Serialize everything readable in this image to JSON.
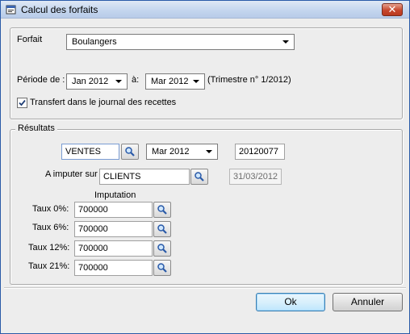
{
  "window": {
    "title": "Calcul des forfaits",
    "close_label": "✕"
  },
  "forfait": {
    "label": "Forfait",
    "value": "Boulangers",
    "periode_label": "Période de :",
    "periode_from": "Jan 2012",
    "a_label": "à:",
    "periode_to": "Mar 2012",
    "trimestre": "(Trimestre n° 1/2012)",
    "transfert_label": "Transfert dans le journal des recettes",
    "transfert_checked": true
  },
  "resultats": {
    "legend": "Résultats",
    "journal_value": "VENTES",
    "month_value": "Mar 2012",
    "piece_number": "20120077",
    "imputer_label": "A imputer sur",
    "imputer_value": "CLIENTS",
    "date_value": "31/03/2012",
    "imputation_header": "Imputation",
    "taux": [
      {
        "label": "Taux 0%:",
        "value": "700000"
      },
      {
        "label": "Taux 6%:",
        "value": "700000"
      },
      {
        "label": "Taux 12%:",
        "value": "700000"
      },
      {
        "label": "Taux 21%:",
        "value": "700000"
      }
    ]
  },
  "buttons": {
    "ok": "Ok",
    "cancel": "Annuler"
  }
}
